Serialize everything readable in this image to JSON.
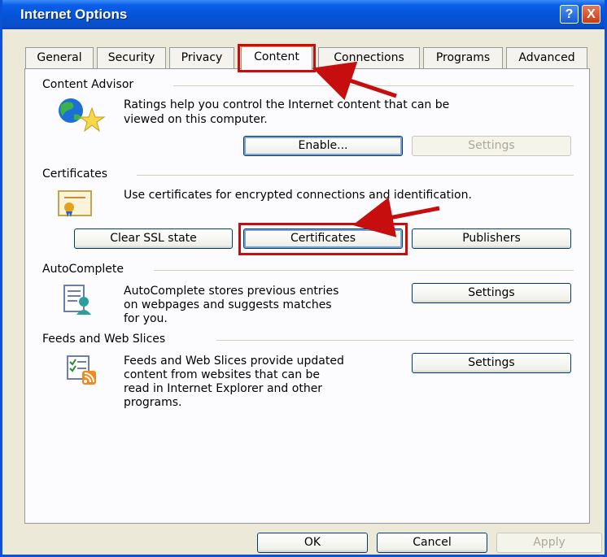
{
  "window": {
    "title": "Internet Options"
  },
  "titlebar": {
    "help_glyph": "?",
    "close_glyph": "X"
  },
  "tabs": [
    {
      "label": "General"
    },
    {
      "label": "Security"
    },
    {
      "label": "Privacy"
    },
    {
      "label": "Content"
    },
    {
      "label": "Connections"
    },
    {
      "label": "Programs"
    },
    {
      "label": "Advanced"
    }
  ],
  "active_tab": "Content",
  "content_advisor": {
    "heading": "Content Advisor",
    "line1": "Ratings help you control the Internet content that can be",
    "line2": "viewed on this computer.",
    "enable_label": "Enable...",
    "settings_label": "Settings"
  },
  "certificates": {
    "heading": "Certificates",
    "description": "Use certificates for encrypted connections and identification.",
    "clear_ssl_label": "Clear SSL state",
    "certificates_label": "Certificates",
    "publishers_label": "Publishers"
  },
  "autocomplete": {
    "heading": "AutoComplete",
    "line1": "AutoComplete stores previous entries",
    "line2": "on webpages and suggests matches",
    "line3": "for you.",
    "settings_label": "Settings"
  },
  "feeds": {
    "heading": "Feeds and Web Slices",
    "line1": "Feeds and Web Slices provide updated",
    "line2": "content from websites that can be",
    "line3": "read in Internet Explorer and other",
    "line4": "programs.",
    "settings_label": "Settings"
  },
  "footer": {
    "ok_label": "OK",
    "cancel_label": "Cancel",
    "apply_label": "Apply"
  },
  "colors": {
    "titlebar": "#0453d8",
    "annotation_red": "#c60e0e",
    "dialog_bg": "#ece9d8"
  }
}
